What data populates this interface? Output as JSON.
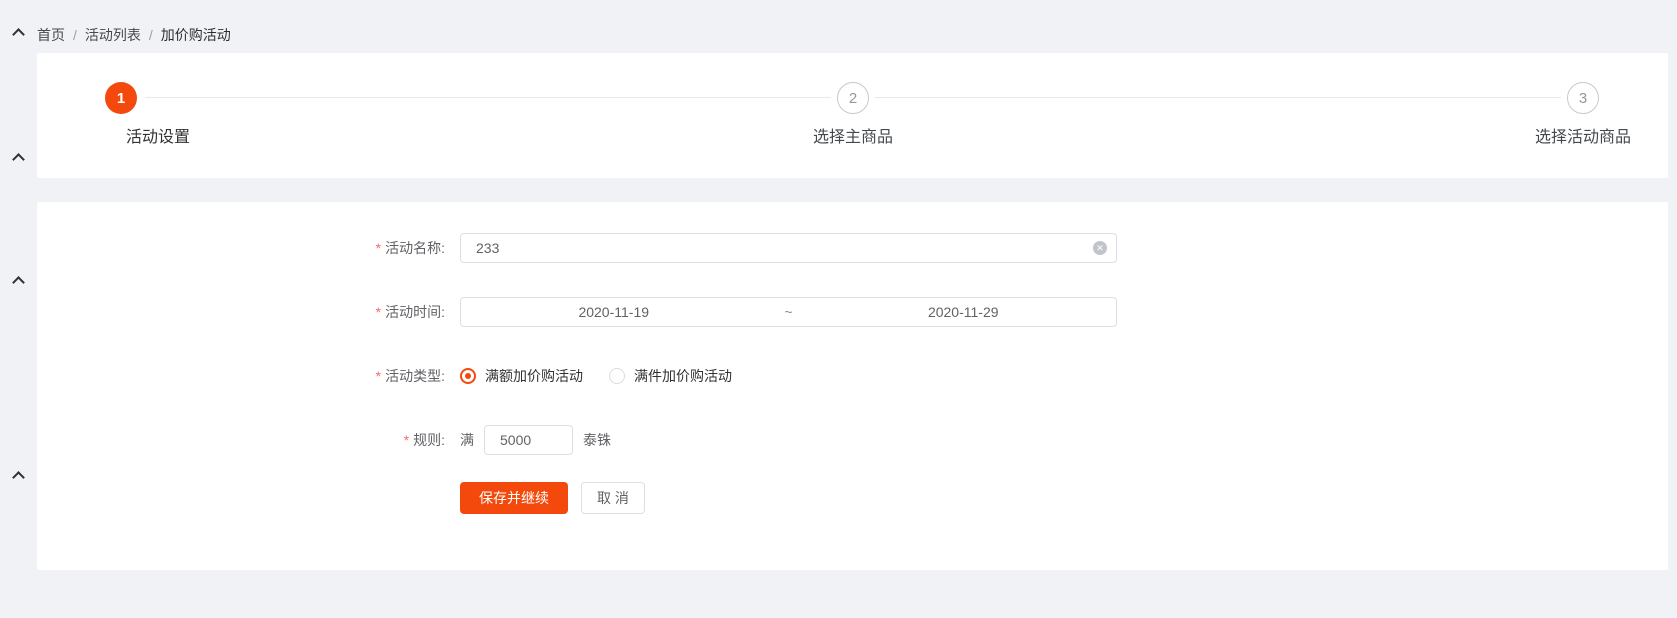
{
  "colors": {
    "accent": "#f4490c",
    "required_mark": "#f56c6c",
    "page_bg": "#f0f2f5"
  },
  "breadcrumb": {
    "separator": "/",
    "items": [
      {
        "label": "首页"
      },
      {
        "label": "活动列表"
      },
      {
        "label": "加价购活动"
      }
    ]
  },
  "stepper": {
    "steps": [
      {
        "number": "1",
        "label": "活动设置",
        "active": true
      },
      {
        "number": "2",
        "label": "选择主商品",
        "active": false
      },
      {
        "number": "3",
        "label": "选择活动商品",
        "active": false
      }
    ]
  },
  "form": {
    "required_mark": "*",
    "name": {
      "label": "活动名称:",
      "value": "233",
      "clear_icon": "circle-close"
    },
    "time": {
      "label": "活动时间:",
      "start": "2020-11-19",
      "separator": "~",
      "end": "2020-11-29"
    },
    "type": {
      "label": "活动类型:",
      "options": [
        {
          "label": "满额加价购活动",
          "selected": true
        },
        {
          "label": "满件加价购活动",
          "selected": false
        }
      ]
    },
    "rule": {
      "label": "规则:",
      "prefix": "满",
      "value": "5000",
      "suffix": "泰铢"
    },
    "buttons": {
      "save": "保存并继续",
      "cancel": "取 消"
    }
  },
  "side_rail": {
    "icon": "chevron-up"
  }
}
